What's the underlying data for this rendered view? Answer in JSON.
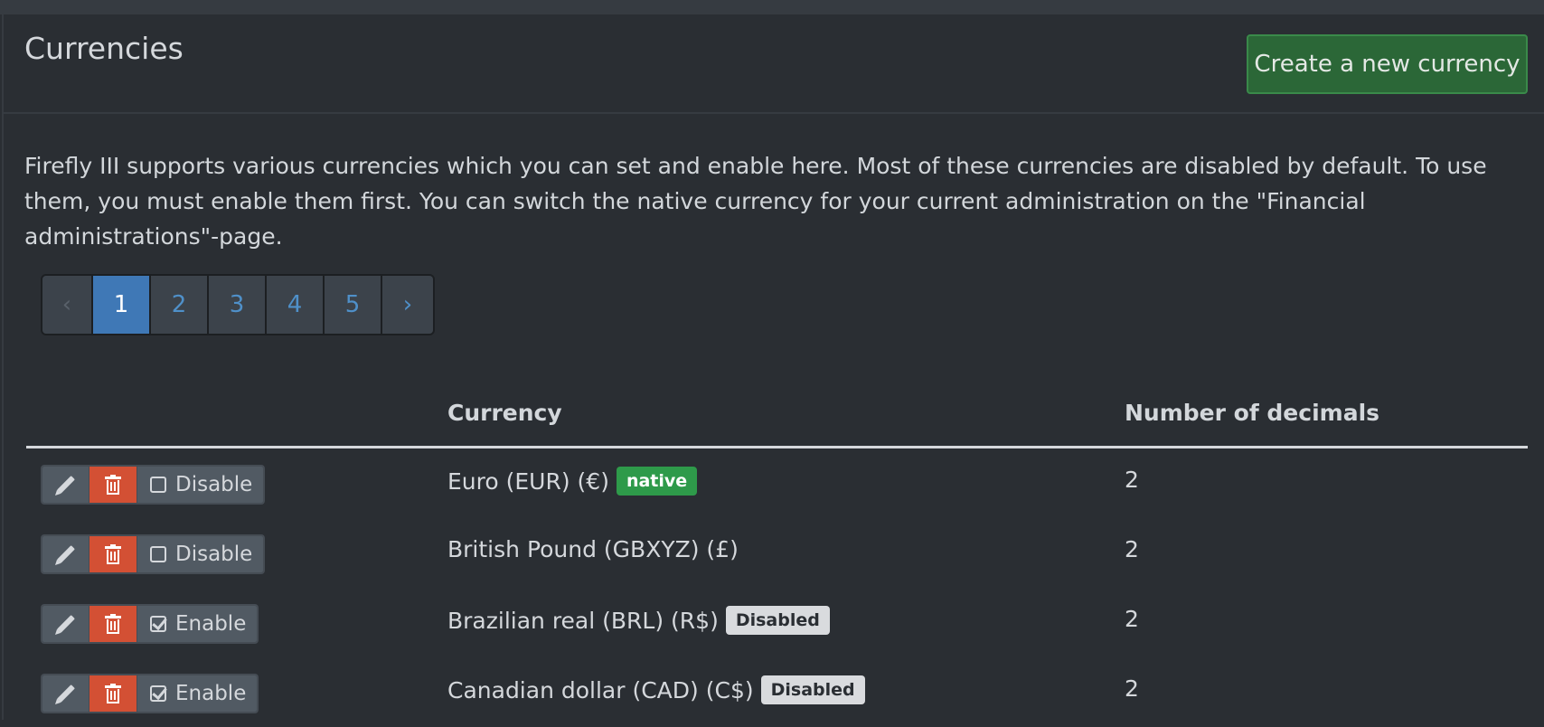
{
  "header": {
    "title": "Currencies",
    "create_button": "Create a new currency"
  },
  "intro_text": "Firefly III supports various currencies which you can set and enable here. Most of these currencies are disabled by default. To use them, you must enable them first. You can switch the native currency for your current administration on the \"Financial administrations\"-page.",
  "pagination": {
    "prev": "‹",
    "next": "›",
    "pages": [
      "1",
      "2",
      "3",
      "4",
      "5"
    ],
    "current_page": "1"
  },
  "table": {
    "columns": [
      "",
      "Currency",
      "Number of decimals"
    ],
    "rows": [
      {
        "name": "Euro (EUR) (€)",
        "badge": "native",
        "decimals": "2",
        "toggle": "Disable",
        "enabled": true
      },
      {
        "name": "British Pound (GBXYZ) (£)",
        "badge": "",
        "decimals": "2",
        "toggle": "Disable",
        "enabled": true
      },
      {
        "name": "Brazilian real (BRL) (R$)",
        "badge": "Disabled",
        "decimals": "2",
        "toggle": "Enable",
        "enabled": false
      },
      {
        "name": "Canadian dollar (CAD) (C$)",
        "badge": "Disabled",
        "decimals": "2",
        "toggle": "Enable",
        "enabled": false
      }
    ]
  },
  "icons": {
    "edit": "pencil-icon",
    "delete": "trash-icon",
    "disable": "checkbox-empty-icon",
    "enable": "checkbox-checked-icon"
  },
  "colors": {
    "background": "#2a2e33",
    "create_button": "#2b6737",
    "active_page": "#3f78b6",
    "delete_button": "#d35034",
    "native_badge": "#2e9a4a",
    "disabled_badge": "#d9dbde"
  }
}
